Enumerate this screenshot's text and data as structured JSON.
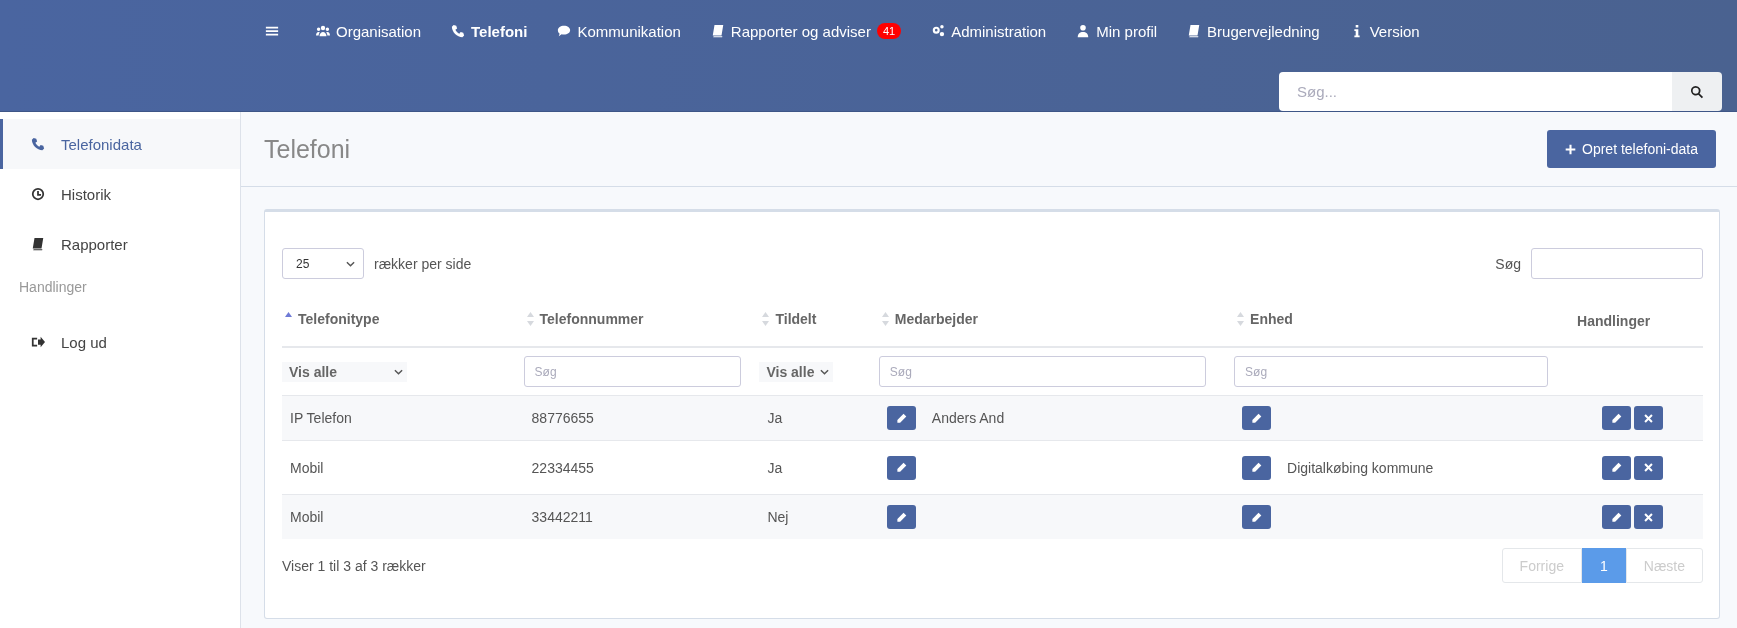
{
  "topnav": {
    "items": [
      {
        "label": "Organisation",
        "selected": false
      },
      {
        "label": "Telefoni",
        "selected": true
      },
      {
        "label": "Kommunikation",
        "selected": false
      },
      {
        "label": "Rapporter og adviser",
        "selected": false,
        "badge": "41"
      },
      {
        "label": "Administration",
        "selected": false
      },
      {
        "label": "Min profil",
        "selected": false
      },
      {
        "label": "Brugervejledning",
        "selected": false
      },
      {
        "label": "Version",
        "selected": false
      }
    ],
    "search": {
      "placeholder": "Søg..."
    }
  },
  "sidebar": {
    "items": [
      {
        "kind": "link",
        "label": "Telefonidata",
        "selected": true
      },
      {
        "kind": "link",
        "label": "Historik",
        "selected": false
      },
      {
        "kind": "link",
        "label": "Rapporter",
        "selected": false
      },
      {
        "kind": "heading",
        "label": "Handlinger"
      },
      {
        "kind": "link",
        "label": "Log ud",
        "selected": false
      }
    ]
  },
  "page": {
    "title": "Telefoni",
    "create_button": "Opret telefoni-data"
  },
  "table": {
    "page_size": "25",
    "page_size_label": "rækker per side",
    "search_label": "Søg",
    "columns": [
      {
        "label": "Telefonitype",
        "sortable": true,
        "sorted": true,
        "filter": {
          "kind": "select",
          "value": "Vis alle"
        }
      },
      {
        "label": "Telefonnummer",
        "sortable": true,
        "sorted": false,
        "filter": {
          "kind": "text",
          "placeholder": "Søg"
        }
      },
      {
        "label": "Tildelt",
        "sortable": true,
        "sorted": false,
        "filter": {
          "kind": "select",
          "value": "Vis alle"
        }
      },
      {
        "label": "Medarbejder",
        "sortable": true,
        "sorted": false,
        "filter": {
          "kind": "text",
          "placeholder": "Søg"
        }
      },
      {
        "label": "Enhed",
        "sortable": true,
        "sorted": false,
        "filter": {
          "kind": "text",
          "placeholder": "Søg"
        }
      },
      {
        "label": "Handlinger",
        "sortable": false,
        "filter": {
          "kind": "none"
        }
      }
    ],
    "rows": [
      {
        "type": "IP Telefon",
        "number": "88776655",
        "assigned": "Ja",
        "employee": "Anders And"
      },
      {
        "type": "Mobil",
        "number": "22334455",
        "assigned": "Ja",
        "unit": "Digitalkøbing kommune"
      },
      {
        "type": "Mobil",
        "number": "33442211",
        "assigned": "Nej"
      }
    ],
    "info": "Viser 1 til 3 af 3 rækker",
    "pagination": [
      {
        "label": "Forrige",
        "selected": false,
        "disabled": true
      },
      {
        "label": "1",
        "selected": true,
        "disabled": false
      },
      {
        "label": "Næste",
        "selected": false,
        "disabled": true
      }
    ]
  }
}
